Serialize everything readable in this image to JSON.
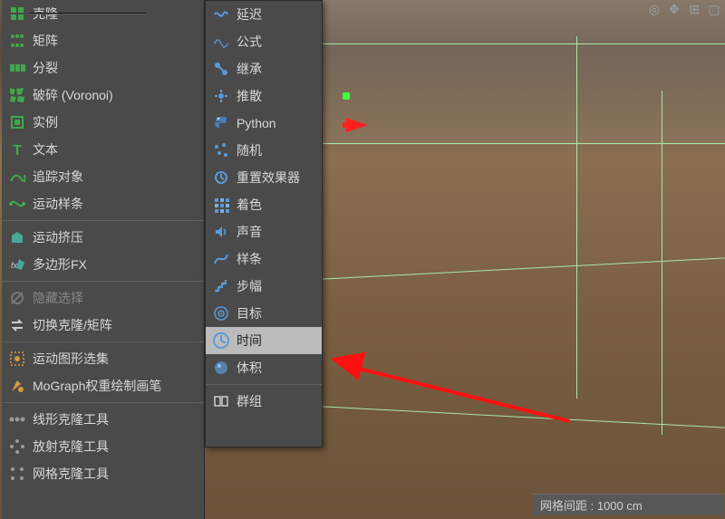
{
  "viewport": {
    "status_label": "网格间距 : 1000 cm"
  },
  "menu1": {
    "items": [
      {
        "label": "克隆",
        "icon": "clone-icon"
      },
      {
        "label": "矩阵",
        "icon": "matrix-icon"
      },
      {
        "label": "分裂",
        "icon": "split-icon"
      },
      {
        "label": "破碎 (Voronoi)",
        "icon": "voronoi-icon"
      },
      {
        "label": "实例",
        "icon": "instance-icon"
      },
      {
        "label": "文本",
        "icon": "text-icon"
      },
      {
        "label": "追踪对象",
        "icon": "tracer-icon"
      },
      {
        "label": "运动样条",
        "icon": "mospline-icon"
      }
    ],
    "items2": [
      {
        "label": "运动挤压",
        "icon": "moextrude-icon"
      },
      {
        "label": "多边形FX",
        "icon": "polyfx-icon"
      }
    ],
    "items3": [
      {
        "label": "隐藏选择",
        "icon": "hide-icon",
        "dim": true
      },
      {
        "label": "切换克隆/矩阵",
        "icon": "swap-icon"
      }
    ],
    "items4": [
      {
        "label": "运动图形选集",
        "icon": "moselection-icon"
      },
      {
        "label": "MoGraph权重绘制画笔",
        "icon": "weight-icon"
      }
    ],
    "items5": [
      {
        "label": "线形克隆工具",
        "icon": "linear-icon"
      },
      {
        "label": "放射克隆工具",
        "icon": "radial-icon"
      },
      {
        "label": "网格克隆工具",
        "icon": "grid-icon"
      }
    ]
  },
  "menu2": {
    "items": [
      {
        "label": "延迟",
        "icon": "delay-icon"
      },
      {
        "label": "公式",
        "icon": "formula-icon"
      },
      {
        "label": "继承",
        "icon": "inherit-icon"
      },
      {
        "label": "推散",
        "icon": "push-icon"
      },
      {
        "label": "Python",
        "icon": "python-icon"
      },
      {
        "label": "随机",
        "icon": "random-icon"
      },
      {
        "label": "重置效果器",
        "icon": "reset-icon"
      },
      {
        "label": "着色",
        "icon": "shader-icon"
      },
      {
        "label": "声音",
        "icon": "sound-icon"
      },
      {
        "label": "样条",
        "icon": "spline-icon"
      },
      {
        "label": "步幅",
        "icon": "step-icon"
      },
      {
        "label": "目标",
        "icon": "target-icon"
      },
      {
        "label": "时间",
        "icon": "time-icon",
        "highlighted": true
      },
      {
        "label": "体积",
        "icon": "volume-icon"
      }
    ],
    "items2": [
      {
        "label": "群组",
        "icon": "group-icon"
      }
    ]
  }
}
